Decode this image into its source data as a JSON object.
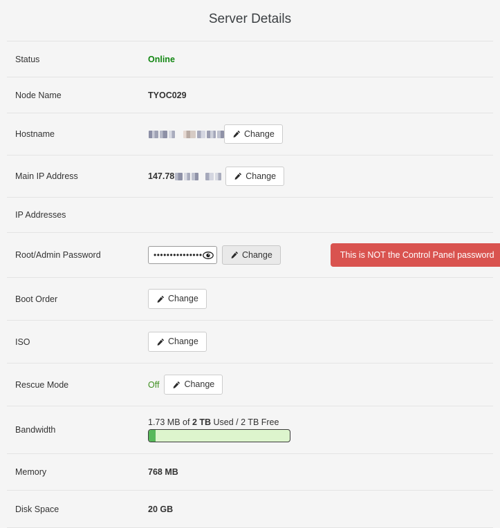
{
  "page": {
    "title": "Server Details",
    "accent_green": "#128712",
    "danger_red": "#d9534f",
    "progress_fill": "#57b85a",
    "progress_track": "#ddf5cd"
  },
  "rows": {
    "status": {
      "label": "Status",
      "value": "Online"
    },
    "node_name": {
      "label": "Node Name",
      "value": "TYOC029"
    },
    "hostname": {
      "label": "Hostname",
      "value": "",
      "redacted": true,
      "change_label": "Change"
    },
    "main_ip": {
      "label": "Main IP Address",
      "value_prefix": "147.78",
      "redacted": true,
      "change_label": "Change"
    },
    "ip_addresses": {
      "label": "IP Addresses",
      "value": ""
    },
    "root_password": {
      "label": "Root/Admin Password",
      "value": "••••••••••••••••",
      "change_label": "Change",
      "warning": "This is NOT the Control Panel password"
    },
    "boot_order": {
      "label": "Boot Order",
      "change_label": "Change"
    },
    "iso": {
      "label": "ISO",
      "change_label": "Change"
    },
    "rescue_mode": {
      "label": "Rescue Mode",
      "state": "Off",
      "change_label": "Change"
    },
    "bandwidth": {
      "label": "Bandwidth",
      "used": "1.73 MB",
      "used_prefix": "1.73 MB of ",
      "total_bold": "2 TB",
      "suffix": " Used / 2 TB Free",
      "percent_used": 5
    },
    "memory": {
      "label": "Memory",
      "value": "768 MB"
    },
    "disk_space": {
      "label": "Disk Space",
      "value": "20 GB"
    }
  }
}
